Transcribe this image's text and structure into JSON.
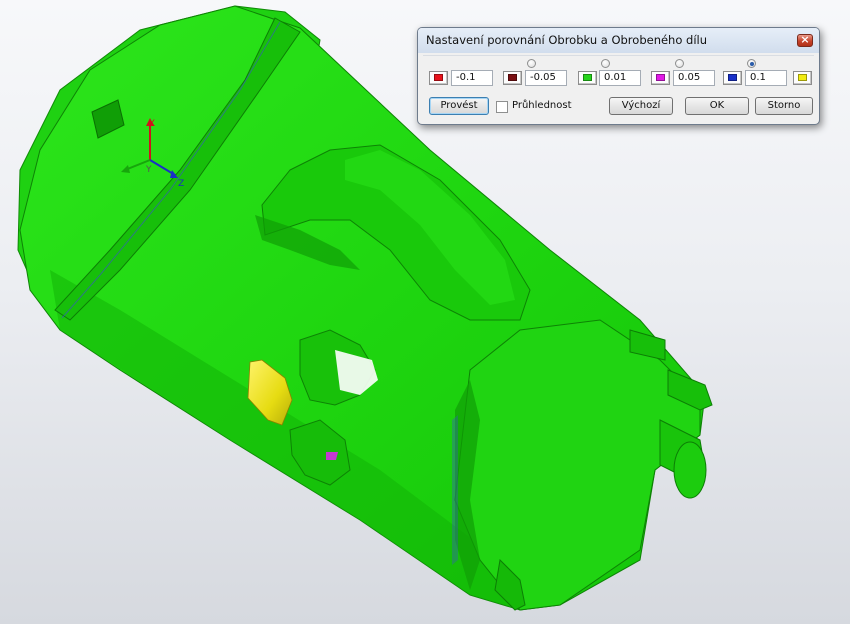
{
  "dialog": {
    "title": "Nastavení porovnání Obrobku a Obrobeného dílu",
    "close_icon": "close-icon",
    "thresholds": [
      "-0.1",
      "-0.05",
      "0.01",
      "0.05",
      "0.1"
    ],
    "selected_threshold_index": 4,
    "colors": [
      "#e8121b",
      "#7a0f12",
      "#27d41c",
      "#e11ae6",
      "#1830c9",
      "#f2ec12"
    ],
    "buttons": {
      "apply": "Provést",
      "default": "Výchozí",
      "ok": "OK",
      "cancel": "Storno"
    },
    "transparency_label": "Průhlednost",
    "transparency_checked": false
  },
  "viewport": {
    "model_color": "#22dd11",
    "deviation_color": "#e8e21a",
    "axes": {
      "x": "X",
      "y": "Y",
      "z": "Z"
    }
  }
}
